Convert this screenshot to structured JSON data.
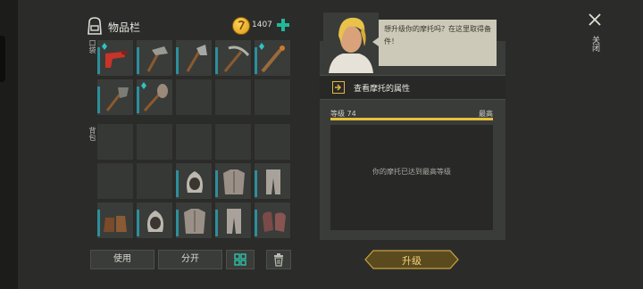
{
  "inventory": {
    "title": "物品栏",
    "coins": "1407",
    "pocket_label": "口袋",
    "backpack_label": "背包"
  },
  "pocket_slots": [
    {
      "item": "flare-gun",
      "filled": true,
      "marked": true
    },
    {
      "item": "stone-hammer",
      "filled": true,
      "marked": false
    },
    {
      "item": "stone-axe",
      "filled": true,
      "marked": false
    },
    {
      "item": "pickaxe",
      "filled": true,
      "marked": false
    },
    {
      "item": "torch-stick",
      "filled": true,
      "marked": true
    },
    {
      "item": "shovel",
      "filled": true,
      "marked": false
    },
    {
      "item": "spiked-club",
      "filled": true,
      "marked": true
    },
    {
      "item": "",
      "filled": false,
      "marked": false
    },
    {
      "item": "",
      "filled": false,
      "marked": false
    },
    {
      "item": "",
      "filled": false,
      "marked": false
    }
  ],
  "backpack_slots": [
    {
      "item": "",
      "filled": false
    },
    {
      "item": "",
      "filled": false
    },
    {
      "item": "",
      "filled": false
    },
    {
      "item": "",
      "filled": false
    },
    {
      "item": "",
      "filled": false
    },
    {
      "item": "",
      "filled": false
    },
    {
      "item": "",
      "filled": false
    },
    {
      "item": "hood",
      "filled": true
    },
    {
      "item": "chest-armor",
      "filled": true
    },
    {
      "item": "leg-armor",
      "filled": true
    },
    {
      "item": "boots",
      "filled": true
    },
    {
      "item": "hood",
      "filled": true
    },
    {
      "item": "chest-armor",
      "filled": true
    },
    {
      "item": "leg-armor",
      "filled": true
    },
    {
      "item": "gloves",
      "filled": true
    }
  ],
  "buttons": {
    "use": "使用",
    "split": "分开"
  },
  "motorcycle": {
    "speech": "想升级你的摩托吗？在这里取得备件！",
    "view_attributes": "查看摩托的属性",
    "level_label": "等级 74",
    "max_label": "最高",
    "progress_fraction": 1.0,
    "max_message": "你的摩托已达到最高等级",
    "upgrade_label": "升级"
  },
  "close_label": "关闭",
  "colors": {
    "accent_gold": "#e6c13a",
    "slot_bar_teal": "#2c8f9c",
    "add_green": "#1fb89a"
  }
}
